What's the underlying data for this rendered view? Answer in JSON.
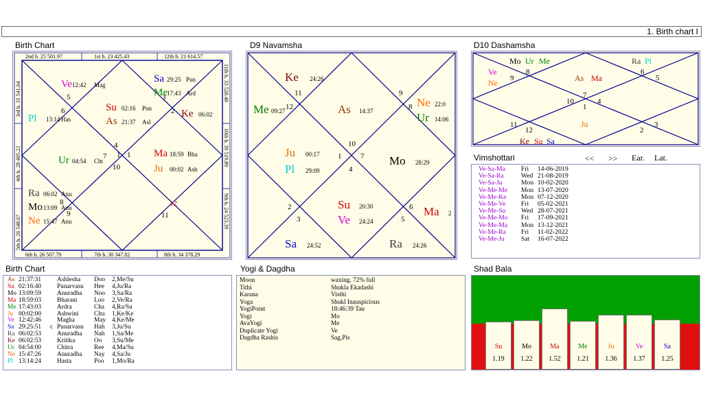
{
  "window": {
    "title": "1. Birth chart I"
  },
  "titles": {
    "birth_chart": "Birth Chart",
    "d9": "D9 Navamsha",
    "d10": "D10 Dashamsha",
    "vimshottari": "Vimshottari",
    "birth_chart_table": "Birth Chart",
    "yogi": "Yogi & Dagdha",
    "shad_bala": "Shad Bala"
  },
  "planet_colors": {
    "Su": "#cc0000",
    "Mo": "#000000",
    "Ma": "#cc0000",
    "Me": "#008000",
    "Ju": "#e07000",
    "Ve": "#cc00cc",
    "Sa": "#0000cc",
    "Ra": "#404040",
    "Ke": "#800000",
    "Ur": "#008000",
    "Ne": "#ff6600",
    "Pl": "#00cccc",
    "As": "#993300"
  },
  "birth_chart": {
    "edges": {
      "top_left": "2nd h.  25  501.97",
      "top_mid": "1st h.  23  425.43",
      "top_right": "12th h.  21  614.57",
      "bottom_left": "6th h.  26  507.79",
      "bottom_mid": "7th h.  30  347.82",
      "bottom_right": "8th h.  34  378.29",
      "left_top": "3rd h.  31  541.64",
      "left_mid": "4th h.  28  405.22",
      "left_bottom": "5th h.  26  548.67",
      "right_top": "11th h.  33  528.48",
      "right_mid": "10th h.  39  519.89",
      "right_bottom": "9th h.  24  523.39"
    },
    "house_numbers": [
      "1",
      "2",
      "3",
      "4",
      "5",
      "6",
      "7",
      "8",
      "9",
      "10",
      "11",
      "12"
    ],
    "planets": [
      {
        "p": "Ve",
        "d": "12:42",
        "n": "Mag"
      },
      {
        "p": "Pl",
        "d": "13:14",
        "n": "Has"
      },
      {
        "p": "Sa",
        "d": "29:25",
        "n": "Pun"
      },
      {
        "p": "Me",
        "d": "17:43",
        "n": "Ard"
      },
      {
        "p": "Su",
        "d": "02:16",
        "n": "Pun"
      },
      {
        "p": "As",
        "d": "21:37",
        "n": "Asl"
      },
      {
        "p": "Ke",
        "d": "06:02",
        "n": ""
      },
      {
        "p": "Ur",
        "d": "04:54",
        "n": "Cht"
      },
      {
        "p": "Ma",
        "d": "18:59",
        "n": "Bha"
      },
      {
        "p": "Ju",
        "d": "00:02",
        "n": "Ash"
      },
      {
        "p": "Ra",
        "d": "06:02",
        "n": "Anu"
      },
      {
        "p": "Mo",
        "d": "13:09",
        "n": "Anu"
      },
      {
        "p": "Ne",
        "d": "15:47",
        "n": "Anu"
      }
    ]
  },
  "d9": {
    "house_numbers": [
      "1",
      "2",
      "3",
      "4",
      "5",
      "6",
      "7",
      "8",
      "9",
      "10",
      "11",
      "12"
    ],
    "planets": [
      {
        "p": "Ke",
        "d": "24:26"
      },
      {
        "p": "Me",
        "d": "09:27"
      },
      {
        "p": "As",
        "d": "14:37"
      },
      {
        "p": "Ne",
        "d": "22:0"
      },
      {
        "p": "Ur",
        "d": "14:06"
      },
      {
        "p": "Ju",
        "d": "00:17"
      },
      {
        "p": "Pl",
        "d": "29:09"
      },
      {
        "p": "Mo",
        "d": "28:29"
      },
      {
        "p": "Su",
        "d": "20:30"
      },
      {
        "p": "Ve",
        "d": "24:24"
      },
      {
        "p": "Ma",
        "d": "2"
      },
      {
        "p": "Sa",
        "d": "24:52"
      },
      {
        "p": "Ra",
        "d": "24:26"
      }
    ]
  },
  "d10": {
    "house_numbers": [
      "1",
      "2",
      "3",
      "4",
      "5",
      "6",
      "7",
      "8",
      "9",
      "10",
      "11",
      "12"
    ],
    "planets": [
      "Mo",
      "Ur",
      "Me",
      "Ra",
      "Pl",
      "Ve",
      "Ne",
      "As",
      "Ma",
      "Ju",
      "Ke",
      "Su",
      "Sa"
    ]
  },
  "vimshottari": {
    "nav": {
      "prev": "<<",
      "next": ">>",
      "earlier": "Ear.",
      "later": "Lat."
    },
    "rows": [
      {
        "code": "Ve-Sa-Ma",
        "day": "Fri",
        "date": "14-06-2019"
      },
      {
        "code": "Ve-Sa-Ra",
        "day": "Wed",
        "date": "21-08-2019"
      },
      {
        "code": "Ve-Sa-Ju",
        "day": "Mon",
        "date": "10-02-2020"
      },
      {
        "code": "Ve-Me-Me",
        "day": "Mon",
        "date": "13-07-2020"
      },
      {
        "code": "Ve-Me-Ke",
        "day": "Mon",
        "date": "07-12-2020"
      },
      {
        "code": "Ve-Me-Ve",
        "day": "Fri",
        "date": "05-02-2021"
      },
      {
        "code": "Ve-Me-Su",
        "day": "Wed",
        "date": "28-07-2021"
      },
      {
        "code": "Ve-Me-Mo",
        "day": "Fri",
        "date": "17-09-2021"
      },
      {
        "code": "Ve-Me-Ma",
        "day": "Mon",
        "date": "13-12-2021"
      },
      {
        "code": "Ve-Me-Ra",
        "day": "Fri",
        "date": "11-02-2022"
      },
      {
        "code": "Ve-Me-Ju",
        "day": "Sat",
        "date": "16-07-2022"
      }
    ]
  },
  "birth_table": [
    {
      "p": "As",
      "t": "21:37:31",
      "r": "",
      "nak": "Ashlesha",
      "syl": "Doo",
      "x": "2,Me/Su"
    },
    {
      "p": "Su",
      "t": "02:16:40",
      "r": "",
      "nak": "Punarvasu",
      "syl": "Hee",
      "x": "4,Ju/Ra"
    },
    {
      "p": "Mo",
      "t": "13:09:59",
      "r": "",
      "nak": "Anuradha",
      "syl": "Noo",
      "x": "3,Sa/Ra"
    },
    {
      "p": "Ma",
      "t": "18:59:03",
      "r": "",
      "nak": "Bharani",
      "syl": "Loo",
      "x": "2,Ve/Ra"
    },
    {
      "p": "Me",
      "t": "17:43:03",
      "r": "",
      "nak": "Ardra",
      "syl": "Cha",
      "x": "4,Ra/Su"
    },
    {
      "p": "Ju",
      "t": "00:02:00",
      "r": "",
      "nak": "Ashwini",
      "syl": "Chu",
      "x": "1,Ke/Ke"
    },
    {
      "p": "Ve",
      "t": "12:42:46",
      "r": "",
      "nak": "Magha",
      "syl": "May",
      "x": "4,Ke/Me"
    },
    {
      "p": "Sa",
      "t": "29:25:51",
      "r": "c",
      "nak": "Punarvasu",
      "syl": "Hah",
      "x": "3,Ju/Su"
    },
    {
      "p": "Ra",
      "t": "06:02:53",
      "r": "",
      "nak": "Anuradha",
      "syl": "Nah",
      "x": "1,Sa/Me"
    },
    {
      "p": "Ke",
      "t": "06:02:53",
      "r": "",
      "nak": "Krittka",
      "syl": "Oo",
      "x": "3,Su/Me"
    },
    {
      "p": "Ur",
      "t": "04:54:00",
      "r": "",
      "nak": "Chitra",
      "syl": "Ree",
      "x": "4,Ma/Su"
    },
    {
      "p": "Ne",
      "t": "15:47:26",
      "r": "",
      "nak": "Anuradha",
      "syl": "Nay",
      "x": "4,Sa/Ju"
    },
    {
      "p": "Pl",
      "t": "13:14:24",
      "r": "",
      "nak": "Hasta",
      "syl": "Poo",
      "x": "1,Mo/Ra"
    }
  ],
  "yogi": [
    {
      "k": "Moon",
      "v": "waxing, 72% full"
    },
    {
      "k": "Tithi",
      "v": "Shukla  Ekadashi"
    },
    {
      "k": "Karana",
      "v": "Visthi"
    },
    {
      "k": "Yoga",
      "v": "Shukl Inauspicious"
    },
    {
      "k": "YogiPoint",
      "v": "18:46:39 Tau"
    },
    {
      "k": "Yogi",
      "v": "Mo"
    },
    {
      "k": "AvaYogi",
      "v": "Me"
    },
    {
      "k": "Duplicate Yogi",
      "v": "Ve"
    },
    {
      "k": "Dagdha Rashis",
      "v": "Sag,Pis"
    }
  ],
  "shad_bala": [
    {
      "p": "Su",
      "v": "1.19",
      "val": 1.19
    },
    {
      "p": "Mo",
      "v": "1.22",
      "val": 1.22
    },
    {
      "p": "Ma",
      "v": "1.52",
      "val": 1.52
    },
    {
      "p": "Me",
      "v": "1.21",
      "val": 1.21
    },
    {
      "p": "Ju",
      "v": "1.36",
      "val": 1.36
    },
    {
      "p": "Ve",
      "v": "1.37",
      "val": 1.37
    },
    {
      "p": "Sa",
      "v": "1.25",
      "val": 1.25
    }
  ]
}
